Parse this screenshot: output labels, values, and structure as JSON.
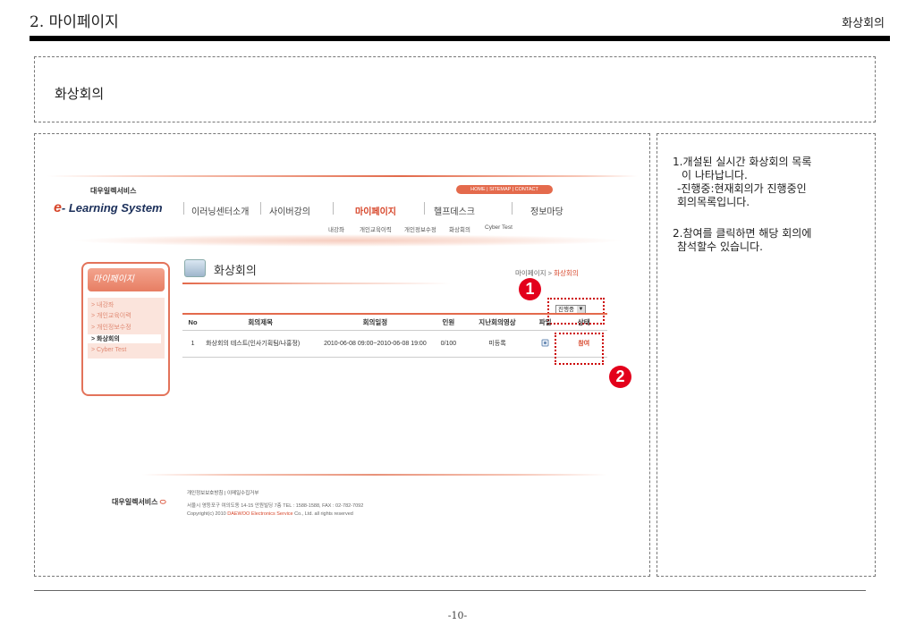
{
  "doc": {
    "title": "2. 마이페이지",
    "section": "화상회의",
    "box_title": "화상회의",
    "page_number": "-10-"
  },
  "site": {
    "brand_small": "대우일렉서비스",
    "brand_logo_e": "e",
    "brand_logo_rest": "- Learning System",
    "util_links": "HOME  |  SITEMAP  |  CONTACT",
    "gnb": [
      "이러닝센터소개",
      "사이버강의",
      "마이페이지",
      "헬프데스크",
      "정보마당"
    ],
    "gnb_active_index": 2,
    "lnb": [
      "내강좌",
      "개인교육이력",
      "개인정보수정",
      "화상회의",
      "Cyber Test"
    ],
    "sidebar": {
      "heading": "마이페이지",
      "items": [
        "> 내강좌",
        "> 개인교육이력",
        "> 개인정보수정",
        "> 화상회의",
        "> Cyber Test"
      ],
      "active_index": 3
    },
    "page_heading": "화상회의",
    "location_prefix": "마이페이지 > ",
    "location_current": "화상회의",
    "filter_value": "진행중",
    "table": {
      "headers": [
        "No",
        "회의제목",
        "회의일정",
        "인원",
        "지난회의영상",
        "파일",
        "상태"
      ],
      "rows": [
        {
          "no": "1",
          "title": "화상회의 테스트(인사기획팀/나홍정)",
          "schedule": "2010-06-08 09:00~2010-06-08 19:00",
          "members": "0/100",
          "past_video": "미등록",
          "file_icon": "file-icon",
          "status": "참여"
        }
      ]
    },
    "footer": {
      "brand": "대우일렉서비스",
      "links": "개인정보보호방침  |  이메일수집거부",
      "address": "서울시 영등포구 여의도동 14-15 안원빌딩 7층   TEL : 1588-1588, FAX : 02-782-7092",
      "copyright_prefix": "Copyright(c) 2010 ",
      "copyright_company": "DAEWOO Electronics Service",
      "copyright_suffix": " Co., Ltd. all rights reserved"
    }
  },
  "callouts": [
    "1",
    "2"
  ],
  "description": {
    "item1_line1": "1.개설된 실시간 화상회의 목록",
    "item1_line2": "이 나타납니다.",
    "item1_line3": "-진행중:현재회의가 진행중인",
    "item1_line4": "회의목록입니다.",
    "item2_line1": "2.참여를 클릭하면 해당 회의에",
    "item2_line2": "참석할수 있습니다."
  },
  "colors": {
    "accent": "#e36a4c",
    "brand_red": "#d7462a",
    "callout": "#e3001b"
  }
}
